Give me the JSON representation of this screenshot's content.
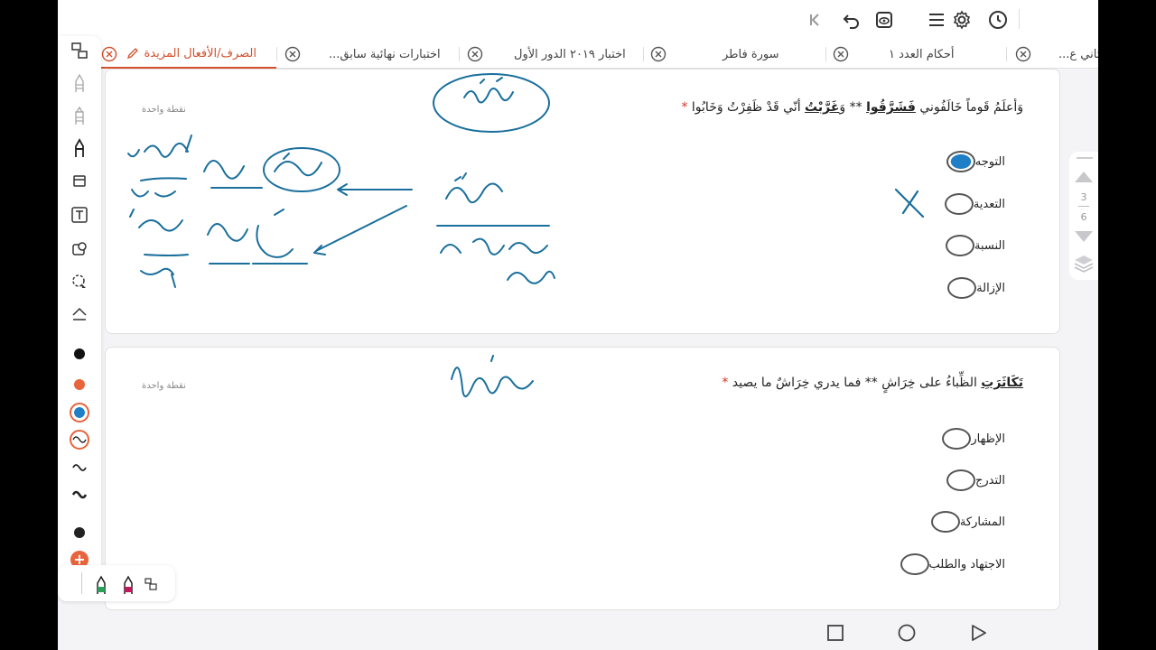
{
  "tabs": [
    {
      "label": "ثاني ع..."
    },
    {
      "label": "أحكام العدد ١"
    },
    {
      "label": "سورة فاطر"
    },
    {
      "label": "اختبار ٢٠١٩ الدور الأول"
    },
    {
      "label": "اختبارات نهائية سابق..."
    },
    {
      "label": "الصرف/الأفعال المزيدة",
      "active": true
    }
  ],
  "questions": [
    {
      "points": "نقطة واحدة",
      "text_pre": "وَأعلَمُ قَوماً خَالَفُوني ",
      "text_u1": "فَشَرَّقُوا",
      "text_mid": " ** وَ",
      "text_u2": "غَرَّبْتُ",
      "text_post": " أنّي قَدْ ظَفِرْتُ وَخَابُوا",
      "required": "*",
      "options": [
        "التوجه",
        "التعدية",
        "النسبة",
        "الإزالة"
      ],
      "selected": 0
    },
    {
      "points": "نقطة واحدة",
      "text_u1": "تَكَاثَرَتِ",
      "text_post": " الظِّباءُ على خِرَاشٍ ** فما يدري خِرَاشٌ ما يصيد",
      "required": "*",
      "options": [
        "الإظهار",
        "التدرج",
        "المشاركة",
        "الاجتهاد والطلب"
      ],
      "selected": null
    }
  ],
  "page_nav": {
    "current": "3",
    "total": "6"
  },
  "colors": {
    "accent": "#d2502c",
    "ink": "#1a6f9c",
    "radio_fill": "#1e7fc6"
  },
  "icons": {
    "toolbar": [
      "clock-icon",
      "settings-icon",
      "menu-icon",
      "eye-icon",
      "undo-icon",
      "collapse-icon"
    ],
    "nav": [
      "back-icon",
      "home-icon",
      "recents-icon"
    ]
  }
}
